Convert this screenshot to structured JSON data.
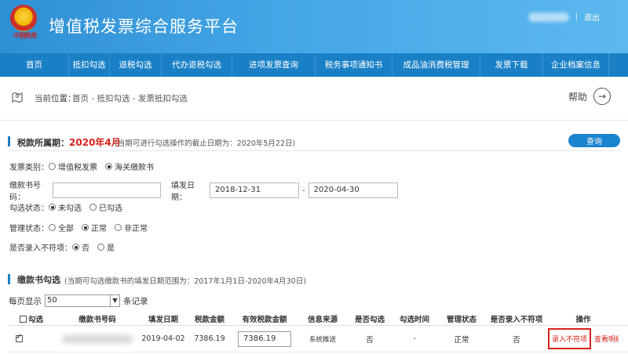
{
  "header": {
    "title": "增值税发票综合服务平台",
    "emblem_caption": "中国税务",
    "logout": "退出",
    "separator": "|"
  },
  "nav": {
    "items": [
      {
        "label": "首页"
      },
      {
        "label": "抵扣勾选"
      },
      {
        "label": "退税勾选"
      },
      {
        "label": "代办退税勾选"
      },
      {
        "label": "进项发票查询"
      },
      {
        "label": "税务事项通知书"
      },
      {
        "label": "成品油消费税管理"
      },
      {
        "label": "发票下载"
      },
      {
        "label": "企业档案信息"
      }
    ]
  },
  "breadcrumb": {
    "label": "当前位置：",
    "path": "首页 - 抵扣勾选 - 发票抵扣勾选",
    "help": "帮助"
  },
  "period": {
    "label": "税款所属期：",
    "value": "2020年4月",
    "note": "(当期可进行勾选操作的截止日期为：2020年5月22日)",
    "query_button": "查询"
  },
  "filters": {
    "invoice_type": {
      "label": "发票类别：",
      "options": [
        "增值税发票",
        "海关缴款书"
      ],
      "selected": 1
    },
    "doc_no": {
      "label": "缴款书号码：",
      "value": ""
    },
    "issue_date": {
      "label": "填发日期：",
      "from": "2018-12-31",
      "dash": "-",
      "to": "2020-04-30"
    },
    "check_status": {
      "label": "勾选状态：",
      "options": [
        "未勾选",
        "已勾选"
      ],
      "selected": 0
    },
    "manage_status": {
      "label": "管理状态：",
      "options": [
        "全部",
        "正常",
        "非正常"
      ],
      "selected": 1
    },
    "mismatch": {
      "label": "是否录入不符项：",
      "options": [
        "否",
        "是"
      ],
      "selected": 0
    }
  },
  "section2": {
    "label": "缴款书勾选",
    "note": "(当期可勾选缴款书的填发日期范围为：2017年1月1日-2020年4月30日)"
  },
  "pager": {
    "prefix": "每页显示",
    "value": "50",
    "suffix": "条记录"
  },
  "table": {
    "columns": [
      "勾选",
      "缴款书号码",
      "填发日期",
      "税款金额",
      "有效税款金额",
      "信息来源",
      "是否勾选",
      "勾选时间",
      "管理状态",
      "是否录入不符项",
      "操作"
    ],
    "rows": [
      {
        "checked": true,
        "doc_no": "",
        "issue_date": "2019-04-02",
        "tax_amount": "7386.19",
        "valid_tax_amount": "7386.19",
        "source": "系统推送",
        "is_checked": "否",
        "check_time": "-",
        "manage_status": "正常",
        "mismatch": "否",
        "op_enter": "录入不符项",
        "op_view": "查看明细"
      }
    ]
  }
}
